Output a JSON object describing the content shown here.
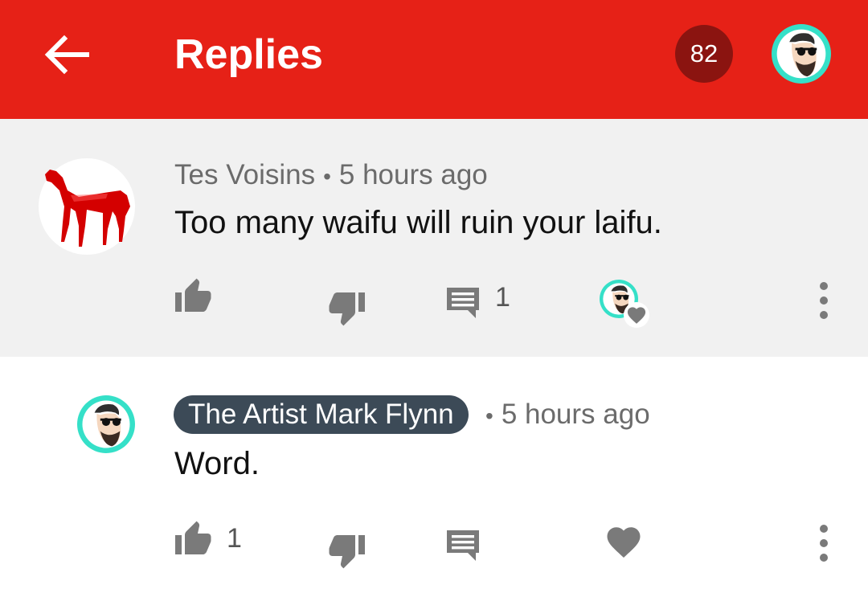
{
  "appbar": {
    "title": "Replies",
    "notification_count": "82",
    "icons": {
      "back": "arrow-back-icon",
      "account": "account-avatar"
    }
  },
  "comment": {
    "author": "Tes Voisins",
    "separator": "•",
    "time": "5 hours ago",
    "text": "Too many waifu will ruin your laifu.",
    "reply_count": "1",
    "icons": [
      "thumb-up-icon",
      "thumb-down-icon",
      "reply-icon",
      "creator-heart-badge",
      "more-vert-icon"
    ]
  },
  "reply": {
    "author": "The Artist Mark Flynn",
    "separator": "•",
    "time": "5 hours ago",
    "text": "Word.",
    "like_count": "1",
    "icons": [
      "thumb-up-icon",
      "thumb-down-icon",
      "reply-icon",
      "heart-icon",
      "more-vert-icon"
    ]
  },
  "colors": {
    "appbar": "#e62117",
    "badge": "#8b1410",
    "comment_bg": "#f1f1f1",
    "author_pill": "#3c4a57",
    "icon": "#7a7a7a",
    "avatar_teal": "#35e0c8"
  }
}
